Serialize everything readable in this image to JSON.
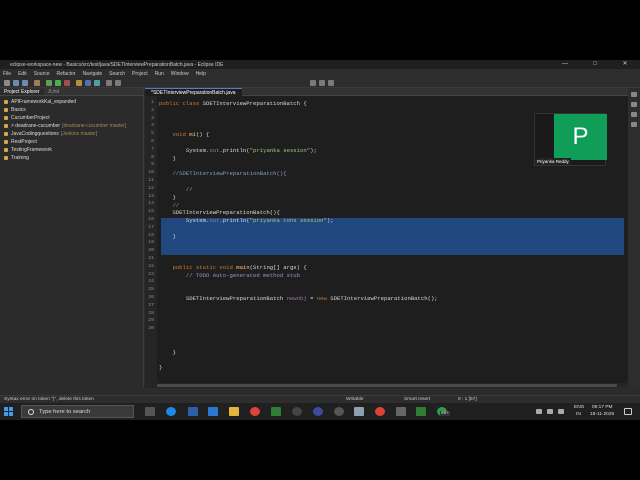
{
  "window": {
    "title": "eclipse-workspace-new - Basics/src/test/java/SDETInterviewPreparationBatch.java - Eclipse IDE",
    "minimize": "—",
    "maximize": "□",
    "close": "✕"
  },
  "menu": [
    "File",
    "Edit",
    "Source",
    "Refactor",
    "Navigate",
    "Search",
    "Project",
    "Run",
    "Window",
    "Help"
  ],
  "left_panel": {
    "tabs": [
      "Project Explorer",
      "JUnit"
    ],
    "tree": [
      {
        "label": "APIFrameworkKal_expanded",
        "extra": ""
      },
      {
        "label": "Basics",
        "extra": ""
      },
      {
        "label": "CucumberProject",
        "extra": ""
      },
      {
        "label": "> deadrane-cucumber",
        "extra": "[deadrane-cucumber master]"
      },
      {
        "label": "JavaCodingquestions",
        "extra": "[Jenkins master]"
      },
      {
        "label": "RestProject",
        "extra": ""
      },
      {
        "label": "TestingFramework",
        "extra": ""
      },
      {
        "label": "Training",
        "extra": ""
      }
    ]
  },
  "editor": {
    "tab": "*SDETInterviewPreparationBatch.java",
    "line_numbers": [
      "1",
      "2",
      "3",
      "4",
      "5",
      "6",
      "7",
      "8",
      "9",
      "10",
      "11",
      "12",
      "13",
      "14",
      "15",
      "16",
      "17",
      "18",
      "19",
      "20",
      "21",
      "22",
      "23",
      "24",
      "25",
      "26",
      "27",
      "28",
      "29",
      "30"
    ],
    "lines": {
      "l1_kw": "public class ",
      "l1_name": "SDETInterviewPreparationBatch {",
      "l5_kw": "void ",
      "l5_fn": "m1",
      "l5_rest": "() {",
      "l7_pre": "System.",
      "l7_out": "out",
      "l7_mid": ".println(",
      "l7_str": "\"priyanka session\"",
      "l7_end": ");",
      "l8": "}",
      "l10": "//SDETInterviewPreparationBatch(){",
      "l12": "//",
      "l13": "}",
      "l14": "//",
      "l15": "SDETInterviewPreparationBatch(){",
      "l16_pre": "System.",
      "l16_out": "out",
      "l16_mid": ".println(",
      "l16_str": "\"priyanka cons session\"",
      "l16_end": ");",
      "l18": "}",
      "l22_kw": "public static void ",
      "l22_fn": "main",
      "l22_rest": "(String[] args) {",
      "l23": "// TODO Auto-generated method stub",
      "l26_pre": "SDETInterviewPreparationBatch ",
      "l26_var": "newobj",
      "l26_mid": " = ",
      "l26_kw": "new ",
      "l26_end": "SDETInterviewPreparationBatch();",
      "l28": "}",
      "l30": "}"
    }
  },
  "video_tile": {
    "initial": "P",
    "name": "Priyanka Reddy",
    "color": "#0f9d58"
  },
  "status_bar": {
    "message": "Syntax error on token \"}\", delete this token",
    "writable": "Writable",
    "insert_mode": "Smart Insert",
    "position": "9 : 1 [57]"
  },
  "taskbar": {
    "search_placeholder": "Type here to search",
    "badge": "99+",
    "language": "ENG",
    "region": "IN",
    "time": "09:17 PM",
    "date": "18-11-2025"
  }
}
